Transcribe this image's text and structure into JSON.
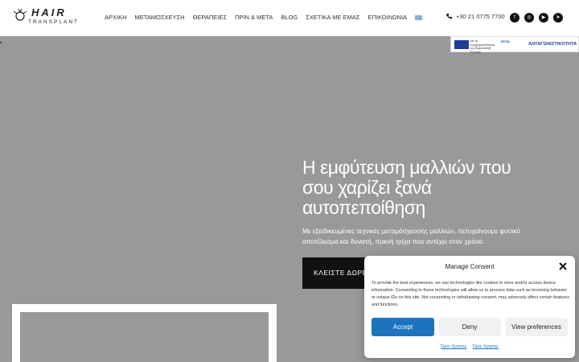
{
  "logo": {
    "top": "HAIR",
    "bottom": "TRANSPLANT"
  },
  "nav": {
    "items": [
      "ΑΡΧΙΚΗ",
      "ΜΕΤΑΜΟΣΧΕΥΣΗ",
      "ΘΕΡΑΠΕΙΕΣ",
      "ΠΡΙΝ & ΜΕΤΑ",
      "BLOG",
      "ΣΧΕΤΙΚΑ ΜΕ ΕΜΑΣ",
      "ΕΠΙΚΟΙΝΩΝΙΑ"
    ]
  },
  "contact": {
    "phone": "+30 21 0775 7700"
  },
  "socials": [
    "facebook-icon",
    "instagram-icon",
    "youtube-icon",
    "telegram-icon"
  ],
  "espa": {
    "right": "ΑΝΤΑΓΩΝΙΣΤΙΚΟΤΗΤΑ",
    "logo": "ΕΣΠΑ",
    "text": "Με τη συγχρηματοδότηση της Ευρωπαϊκής Ένωσης"
  },
  "hero": {
    "title": "Η εμφύτευση μαλλιών που σου χαρίζει ξανά αυτοπεποίθηση",
    "subtitle": "Με εξειδικευμένες τεχνικές μεταμόσχευσης μαλλιών, πετυχαίνουμε φυσικό αποτέλεσμα και δυνατή, πυκνή τρίχα που αντέχει στον χρόνο.",
    "cta": "ΚΛΕΙΣΤΕ ΔΩΡΕ"
  },
  "consent": {
    "title": "Manage Consent",
    "text": "To provide the best experiences, we use technologies like cookies to store and/or access device information. Consenting to these technologies will allow us to process data such as browsing behavior or unique IDs on this site. Not consenting or withdrawing consent, may adversely affect certain features and functions.",
    "accept": "Accept",
    "deny": "Deny",
    "view": "View preferences",
    "link1": "Όροι Χρήσης",
    "link2": "Όροι Χρήσης"
  },
  "colors": {
    "hero_bg": "#999999",
    "accept": "#1e73be",
    "cta": "#111111"
  }
}
